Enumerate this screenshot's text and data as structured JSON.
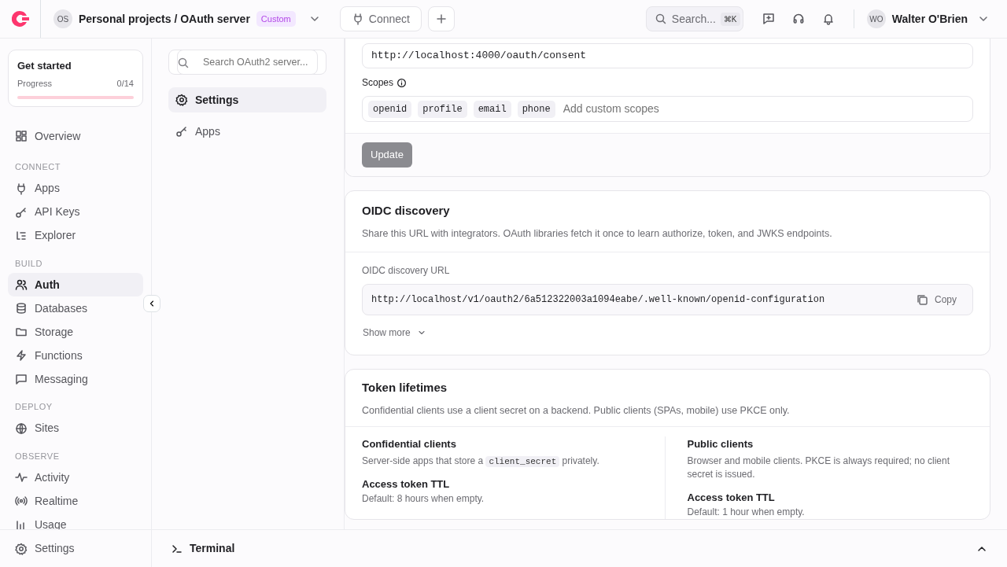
{
  "header": {
    "org_avatar": "OS",
    "breadcrumb": "Personal projects / OAuth server",
    "plan_badge": "Custom",
    "connect_button": "Connect",
    "search": {
      "placeholder": "Search...",
      "shortcut": "⌘K"
    },
    "user": {
      "avatar": "WO",
      "name": "Walter O'Brien"
    }
  },
  "sidebar": {
    "get_started": {
      "title": "Get started",
      "progress_label": "Progress",
      "progress_count": "0/14",
      "level": 0
    },
    "sections": [
      {
        "items": [
          {
            "label": "Overview",
            "selected": false
          }
        ]
      },
      {
        "heading": "CONNECT",
        "items": [
          {
            "label": "Apps",
            "selected": false
          },
          {
            "label": "API Keys",
            "selected": false
          },
          {
            "label": "Explorer",
            "selected": false
          }
        ]
      },
      {
        "heading": "BUILD",
        "items": [
          {
            "label": "Auth",
            "selected": true
          },
          {
            "label": "Databases",
            "selected": false
          },
          {
            "label": "Storage",
            "selected": false
          },
          {
            "label": "Functions",
            "selected": false
          },
          {
            "label": "Messaging",
            "selected": false
          }
        ]
      },
      {
        "heading": "DEPLOY",
        "items": [
          {
            "label": "Sites",
            "selected": false
          }
        ]
      },
      {
        "heading": "OBSERVE",
        "items": [
          {
            "label": "Activity",
            "selected": false
          },
          {
            "label": "Realtime",
            "selected": false
          },
          {
            "label": "Usage",
            "selected": false
          }
        ]
      }
    ],
    "footer_item": "Settings"
  },
  "subnav": {
    "search": {
      "placeholder": "Search OAuth2 server..."
    },
    "items": [
      {
        "label": "Settings",
        "selected": true
      },
      {
        "label": "Apps",
        "selected": false
      }
    ]
  },
  "consent_card": {
    "url_value": "http://localhost:4000/oauth/consent",
    "scopes_label": "Scopes",
    "scopes": [
      "openid",
      "profile",
      "email",
      "phone"
    ],
    "scopes_placeholder": "Add custom scopes",
    "update_button": {
      "label": "Update",
      "disabled": true
    }
  },
  "discovery_card": {
    "title": "OIDC discovery",
    "description": "Share this URL with integrators. OAuth libraries fetch it once to learn authorize, token, and JWKS endpoints.",
    "url_label": "OIDC discovery URL",
    "url": "http://localhost/v1/oauth2/6a512322003a1094eabe/.well-known/openid-configuration",
    "copy_button": "Copy",
    "show_more": "Show more"
  },
  "token_card": {
    "title": "Token lifetimes",
    "description": "Confidential clients use a client secret on a backend. Public clients (SPAs, mobile) use PKCE only.",
    "columns": [
      {
        "title": "Confidential clients",
        "description_parts": [
          {
            "kind": "text",
            "text": "Server-side apps that store a "
          },
          {
            "kind": "code",
            "text": "client_secret"
          },
          {
            "kind": "text",
            "text": " privately."
          }
        ],
        "field_label": "Access token TTL",
        "field_hint": "Default: 8 hours when empty."
      },
      {
        "title": "Public clients",
        "description_parts": [
          {
            "kind": "text",
            "text": "Browser and mobile clients. PKCE is always required; no client secret is issued."
          }
        ],
        "field_label": "Access token TTL",
        "field_hint": "Default: 1 hour when empty."
      }
    ]
  },
  "terminal": {
    "label": "Terminal"
  }
}
